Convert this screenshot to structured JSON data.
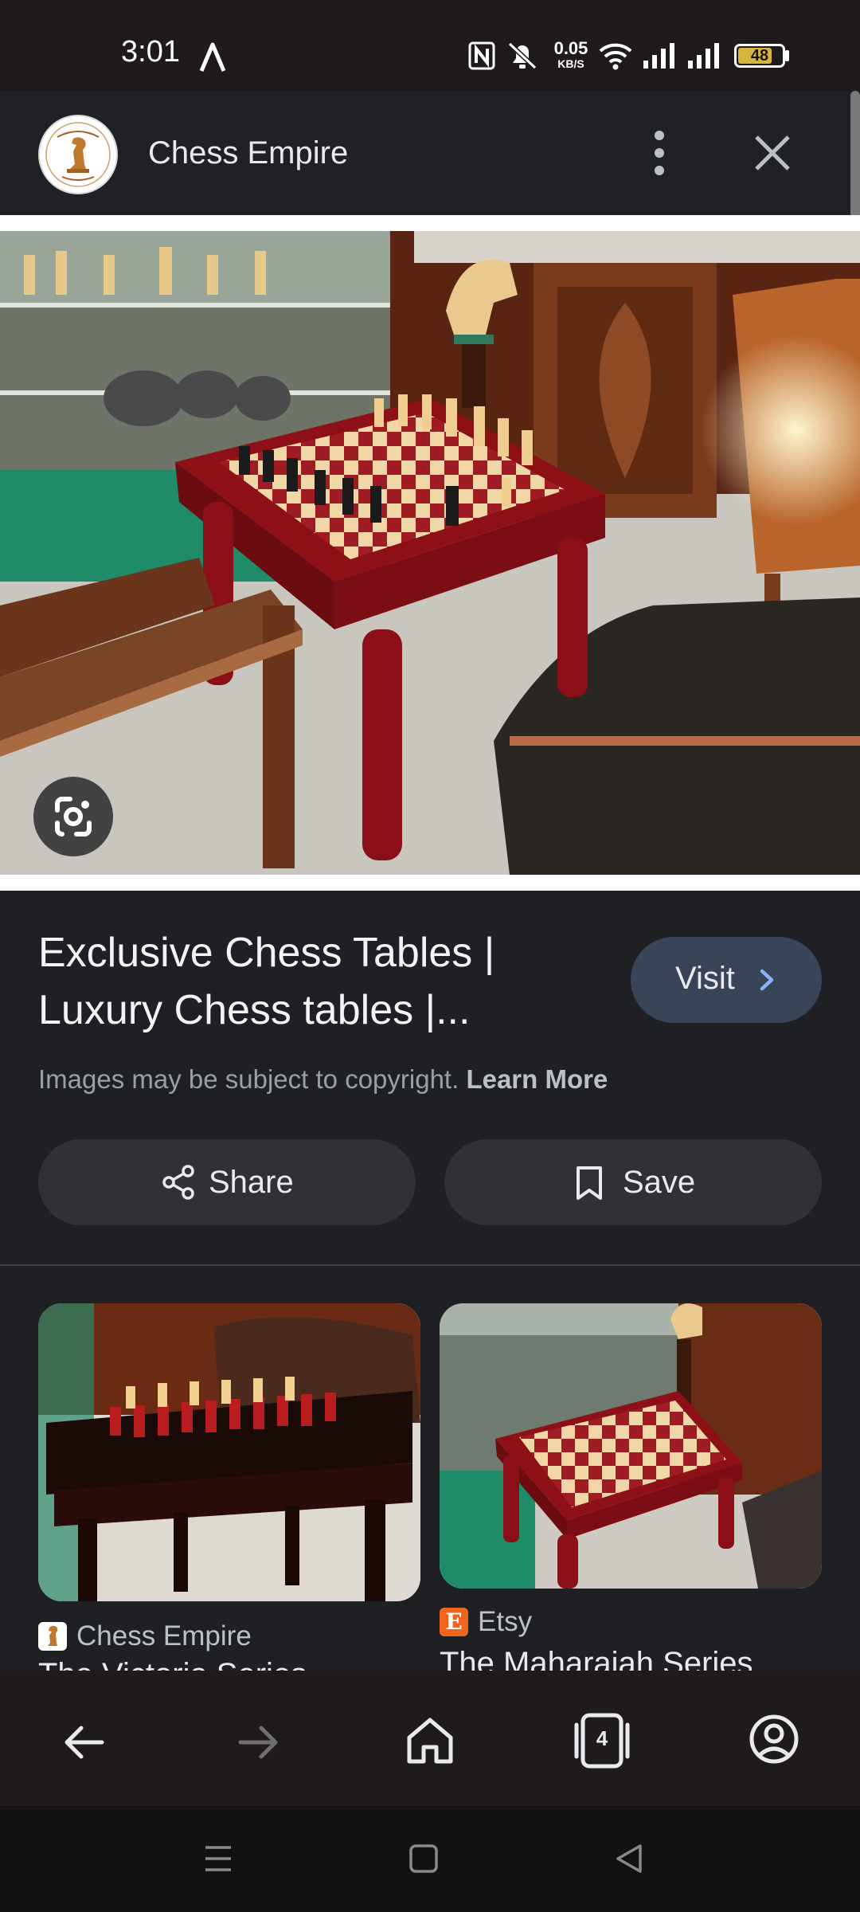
{
  "status_bar": {
    "time": "3:01",
    "net_speed_value": "0.05",
    "net_speed_unit": "KB/S",
    "battery": "48",
    "icons": [
      "navigation-arrow-icon",
      "nfc-icon",
      "mute-icon",
      "wifi-icon",
      "signal-icon",
      "signal-icon",
      "battery-icon"
    ]
  },
  "header": {
    "site_name": "Chess Empire",
    "avatar_icon": "chess-empire-logo",
    "more_icon": "more-vert-icon",
    "close_icon": "close-icon"
  },
  "result": {
    "title_line1": "Exclusive Chess Tables |",
    "title_line2": "Luxury Chess tables |...",
    "visit_label": "Visit",
    "copyright_text": "Images may be subject to copyright.",
    "learn_more": "Learn More",
    "share_label": "Share",
    "save_label": "Save"
  },
  "related": [
    {
      "source": "Chess Empire",
      "title": "The Victoria Series"
    },
    {
      "source": "Etsy",
      "title": "The Maharajah Series"
    }
  ],
  "browser_nav": {
    "tab_count": "4",
    "icons": [
      "back-icon",
      "forward-icon",
      "home-icon",
      "tabs-icon",
      "account-icon"
    ]
  },
  "system_nav": {
    "icons": [
      "recents-icon",
      "home-square-icon",
      "back-triangle-icon"
    ]
  },
  "colors": {
    "background": "#1f2024",
    "visit_button": "#394457",
    "action_button": "#303134",
    "etsy": "#f1641e"
  }
}
